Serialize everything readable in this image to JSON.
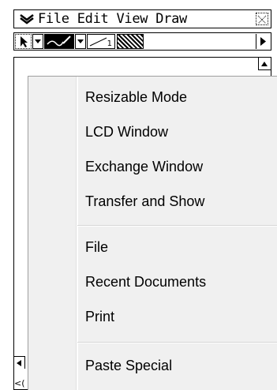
{
  "menubar": {
    "items": [
      "File",
      "Edit",
      "View",
      "Draw"
    ]
  },
  "toolbar": {
    "line_tool_subscript": "1"
  },
  "document": {
    "bottom_left_label": "<("
  },
  "context_menu": {
    "groups": [
      [
        "Resizable Mode",
        "LCD Window",
        "Exchange Window",
        "Transfer and Show"
      ],
      [
        "File",
        "Recent Documents",
        "Print"
      ],
      [
        "Paste Special"
      ]
    ]
  },
  "colors": {
    "menu_background": "#f0f0f0",
    "border": "#000000"
  }
}
